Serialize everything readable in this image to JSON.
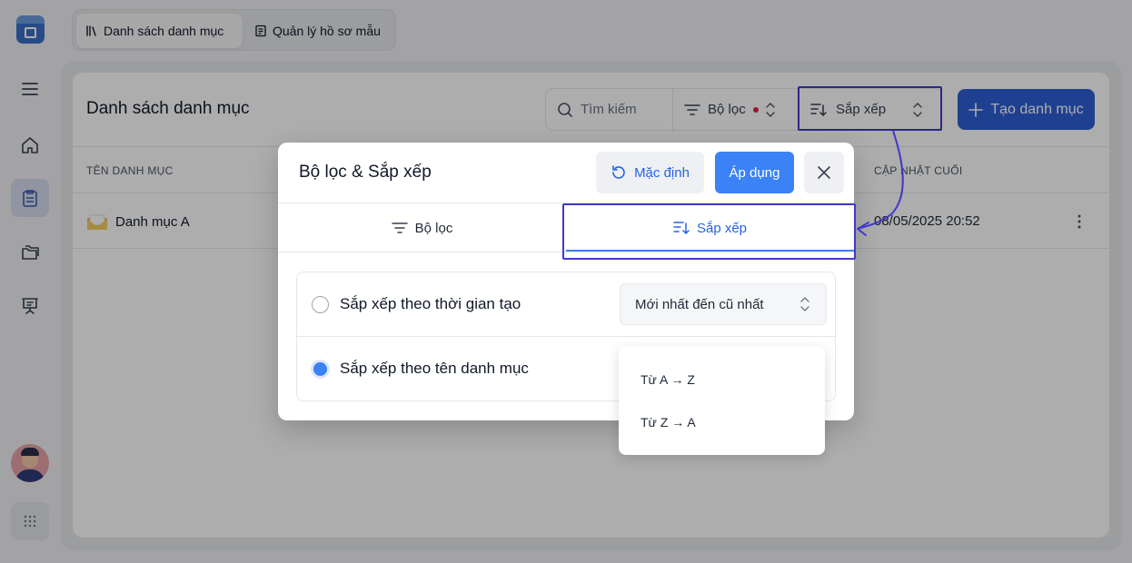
{
  "topbar": {
    "tabs": [
      {
        "label": "Danh sách danh mục",
        "active": true
      },
      {
        "label": "Quản lý hồ sơ mẫu",
        "active": false
      }
    ]
  },
  "page": {
    "title": "Danh sách danh mục",
    "search_label": "Tìm kiếm",
    "filter_label": "Bộ lọc",
    "sort_label": "Sắp xếp",
    "create_label": "Tạo danh mục"
  },
  "table": {
    "columns": [
      "TÊN DANH MỤC",
      "CẬP NHẬT CUỐI"
    ],
    "rows": [
      {
        "name": "Danh mục A",
        "updated": "08/05/2025 20:52"
      }
    ]
  },
  "modal": {
    "title": "Bộ lọc & Sắp xếp",
    "default_label": "Mặc định",
    "apply_label": "Áp dụng",
    "tabs": [
      {
        "label": "Bộ lọc",
        "active": false
      },
      {
        "label": "Sắp xếp",
        "active": true
      }
    ],
    "options": [
      {
        "label": "Sắp xếp theo thời gian tạo",
        "selected": false,
        "select_value": "Mới nhất đến cũ nhất"
      },
      {
        "label": "Sắp xếp theo tên danh mục",
        "selected": true
      }
    ],
    "dropdown_options": [
      "Từ A → Z",
      "Từ Z → A"
    ]
  },
  "colors": {
    "accent": "#3b82f6",
    "primary_button": "#2f5fd6",
    "annotation": "#4338ca",
    "filter_dot": "#e11d48"
  }
}
